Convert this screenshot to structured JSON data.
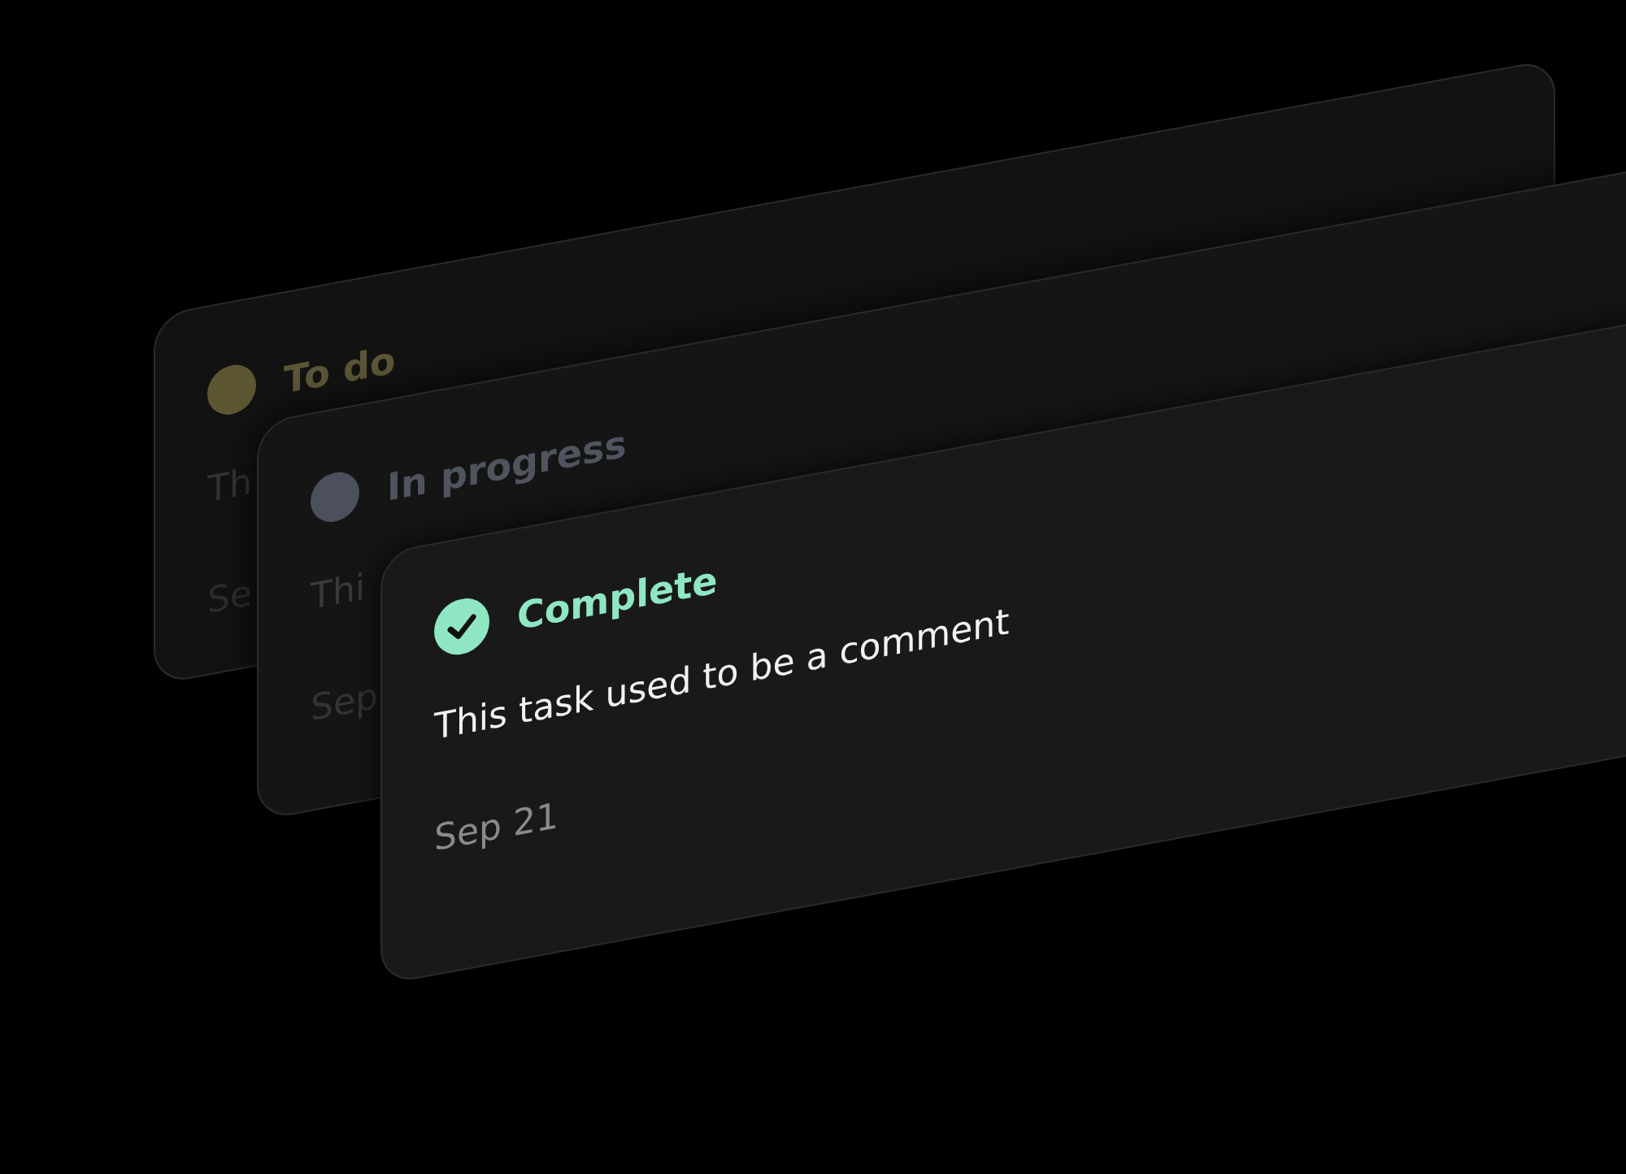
{
  "cards": [
    {
      "kind": "todo",
      "status": "To do",
      "color": "#5c5631",
      "text": "Th",
      "date": "Se"
    },
    {
      "kind": "progress",
      "status": "In progress",
      "color": "#4b505c",
      "text": "Thi",
      "date": "Sep"
    },
    {
      "kind": "complete",
      "status": "Complete",
      "color": "#8fe6c3",
      "text": "This task used to be a comment",
      "date": "Sep 21"
    }
  ]
}
